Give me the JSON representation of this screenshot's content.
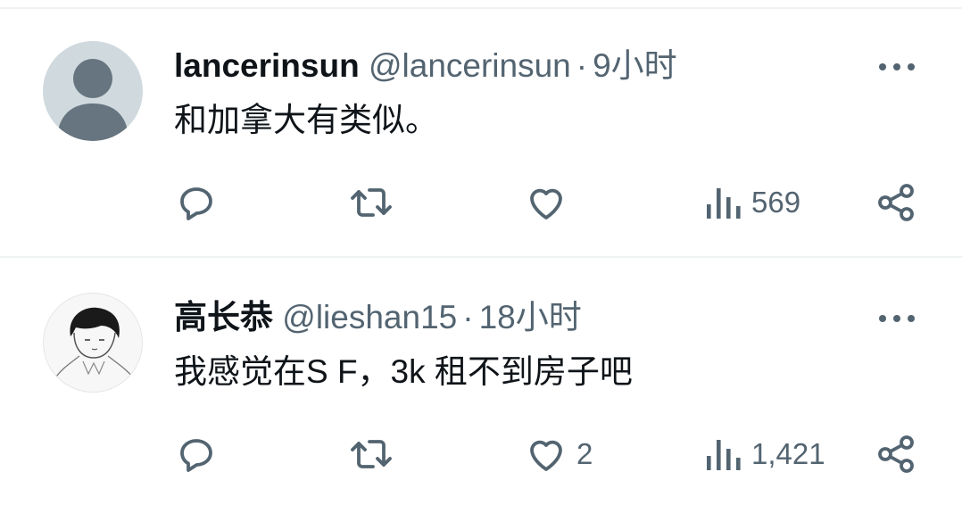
{
  "tweets": [
    {
      "display_name": "lancerinsun",
      "handle": "@lancerinsun",
      "separator": "·",
      "time": "9小时",
      "text": "和加拿大有类似。",
      "likes": "",
      "views": "569",
      "avatar": "default-avatar-icon"
    },
    {
      "display_name": "高长恭",
      "handle": "@lieshan15",
      "separator": "·",
      "time": "18小时",
      "text": "我感觉在S F，3k 租不到房子吧",
      "likes": "2",
      "views": "1,421",
      "avatar": "sketch-portrait-avatar"
    }
  ],
  "colors": {
    "text_primary": "#0f1419",
    "text_secondary": "#536471",
    "divider": "#eff3f4",
    "default_avatar_bg": "#cfd9de",
    "default_avatar_fg": "#66757f"
  }
}
